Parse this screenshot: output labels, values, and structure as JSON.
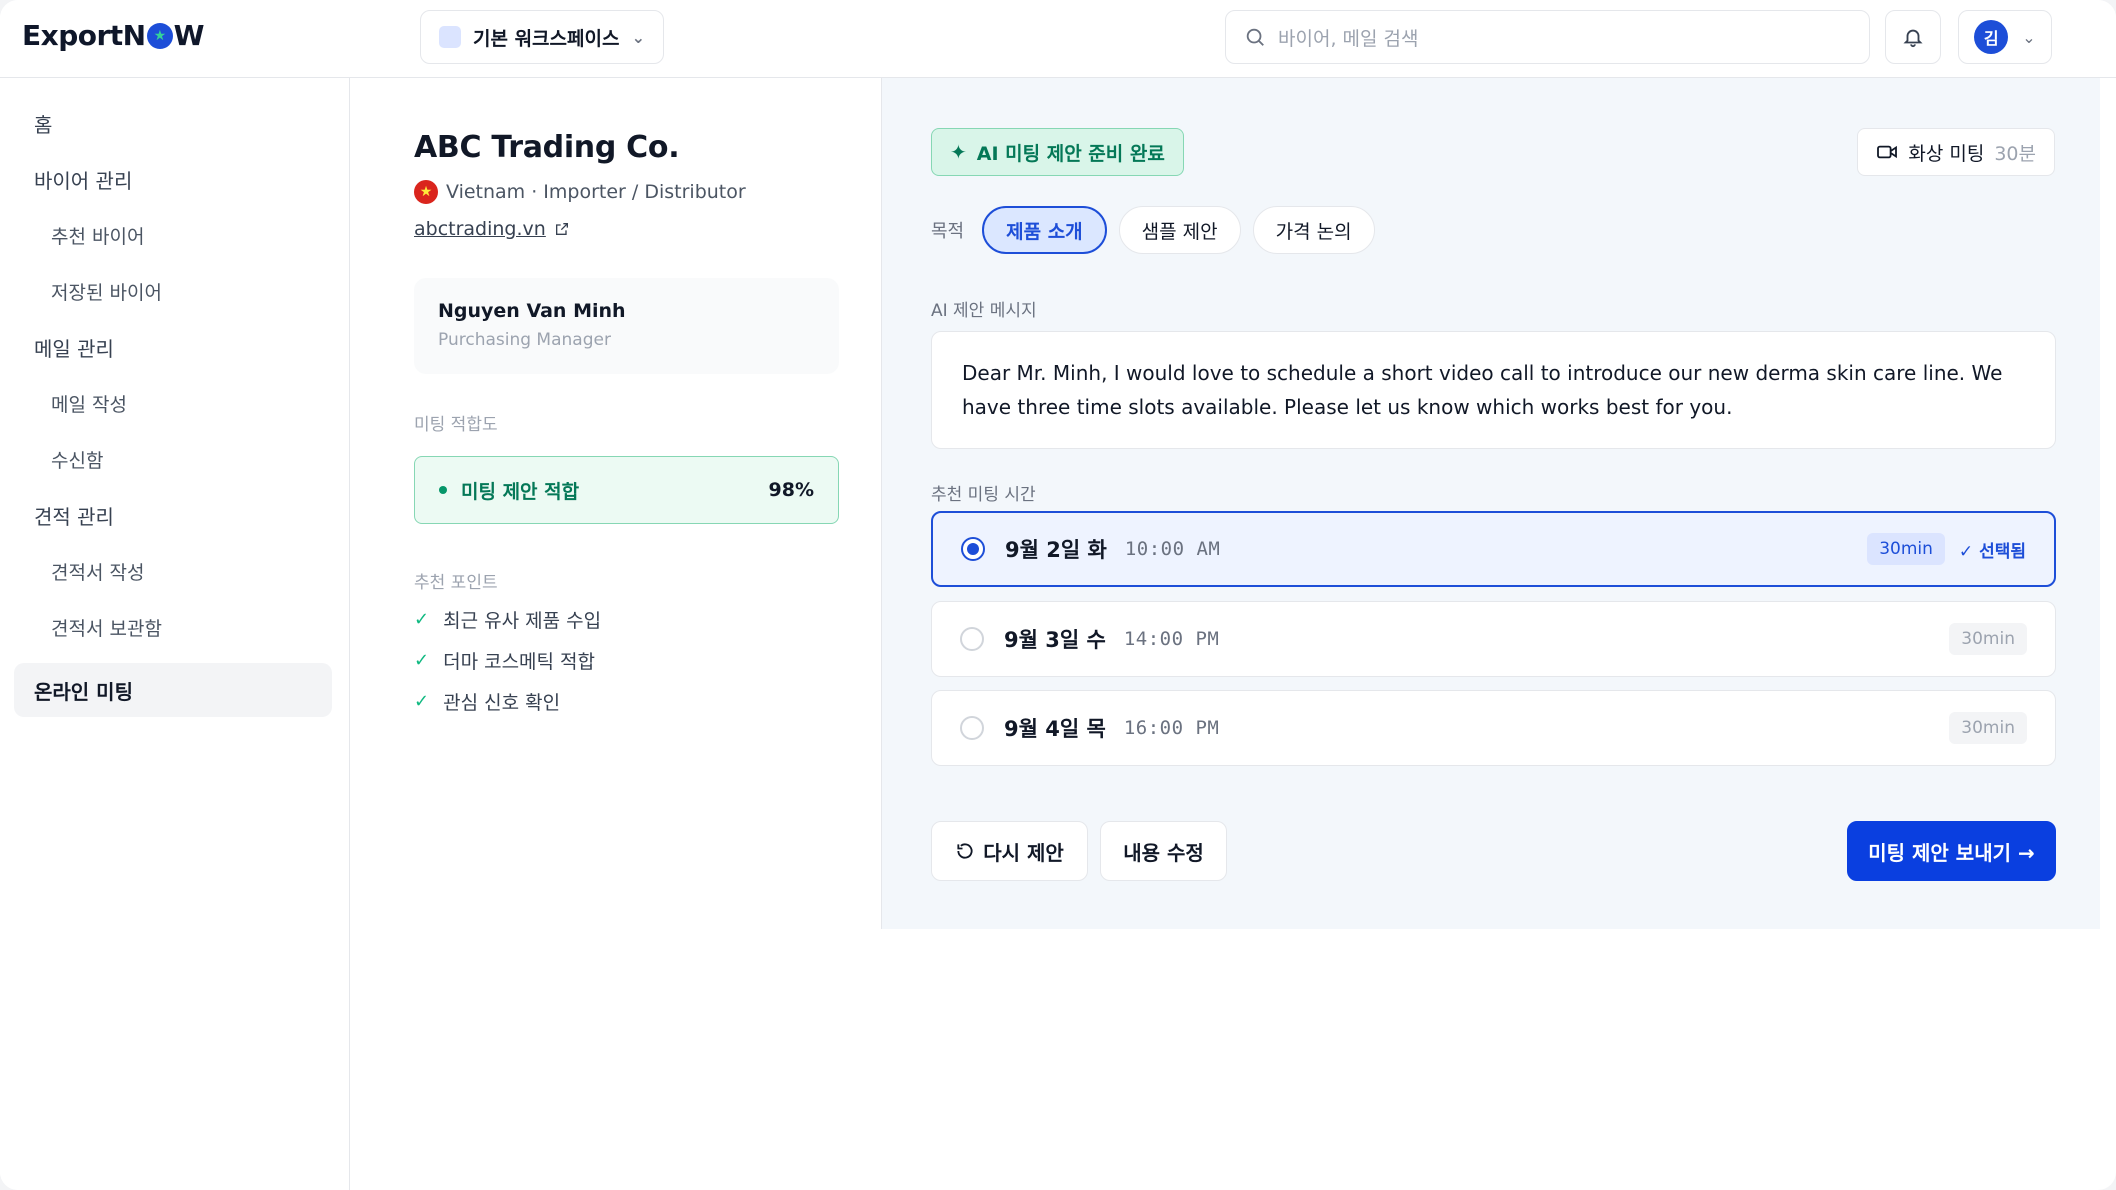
{
  "app": {
    "logo_pre": "Export",
    "logo_post": "W",
    "logo_mid": "N"
  },
  "workspace": {
    "label": "기본 워크스페이스"
  },
  "search": {
    "placeholder": "바이어, 메일 검색"
  },
  "user": {
    "initial": "김"
  },
  "sidebar": {
    "items": [
      {
        "label": "홈"
      },
      {
        "label": "바이어 관리"
      },
      {
        "label": "추천 바이어"
      },
      {
        "label": "저장된 바이어"
      },
      {
        "label": "메일 관리"
      },
      {
        "label": "메일 작성"
      },
      {
        "label": "수신함"
      },
      {
        "label": "견적 관리"
      },
      {
        "label": "견적서 작성"
      },
      {
        "label": "견적서 보관함"
      },
      {
        "label": "온라인 미팅"
      }
    ]
  },
  "buyer": {
    "name": "ABC Trading Co.",
    "meta": "Vietnam · Importer / Distributor",
    "website": "abctrading.vn",
    "contact_name": "Nguyen Van Minh",
    "contact_role": "Purchasing Manager",
    "fit_label": "미팅 적합도",
    "fit_status": "미팅 제안 적합",
    "fit_score": "98%",
    "points_label": "추천 포인트",
    "points": [
      "최근 유사 제품 수입",
      "더마 코스메틱 적합",
      "관심 신호 확인"
    ]
  },
  "meeting": {
    "ready_label": "AI 미팅 제안 준비 완료",
    "video_label": "화상 미팅",
    "video_duration": "30분",
    "purpose_label": "목적",
    "purposes": [
      "제품 소개",
      "샘플 제안",
      "가격 논의"
    ],
    "active_purpose": "제품 소개",
    "message_label": "AI 제안 메시지",
    "message": "Dear Mr. Minh, I would love to schedule a short video call to introduce our new derma skin care line. We have three time slots available. Please let us know which works best for you.",
    "slots_label": "추천 미팅 시간",
    "slots": [
      {
        "date": "9월 2일 화",
        "time": "10:00 AM",
        "duration": "30min",
        "selected_label": "✓ 선택됨"
      },
      {
        "date": "9월 3일 수",
        "time": "14:00 PM",
        "duration": "30min"
      },
      {
        "date": "9월 4일 목",
        "time": "16:00 PM",
        "duration": "30min"
      }
    ],
    "retry_label": "다시 제안",
    "edit_label": "내용 수정",
    "send_label": "미팅 제안 보내기 →"
  },
  "colors": {
    "accent": "#0a3fe0",
    "success": "#047857",
    "success_bg": "#ecfaf3"
  }
}
